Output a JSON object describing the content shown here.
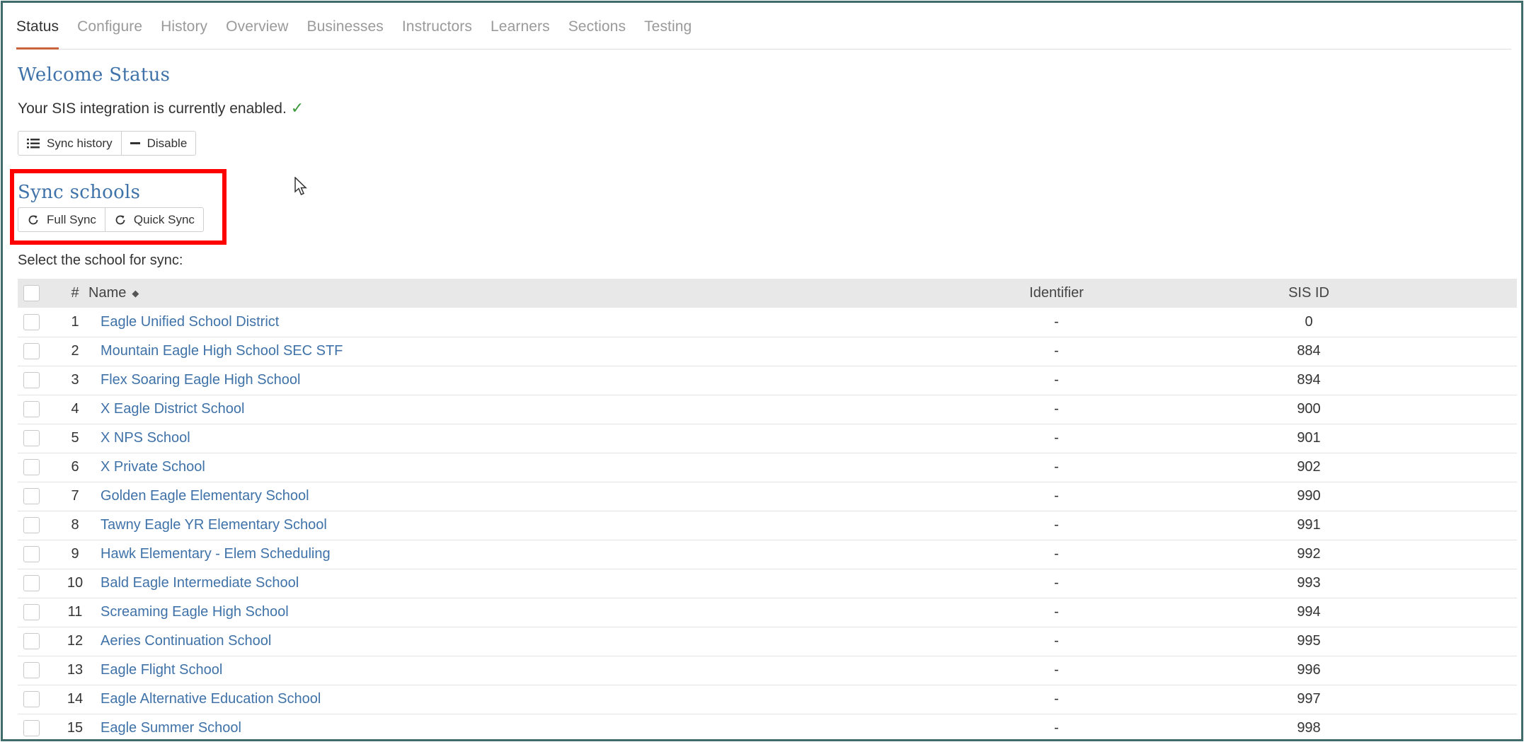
{
  "tabs": [
    {
      "label": "Status",
      "active": true
    },
    {
      "label": "Configure"
    },
    {
      "label": "History"
    },
    {
      "label": "Overview"
    },
    {
      "label": "Businesses"
    },
    {
      "label": "Instructors"
    },
    {
      "label": "Learners"
    },
    {
      "label": "Sections"
    },
    {
      "label": "Testing"
    }
  ],
  "welcome": {
    "title": "Welcome Status",
    "status_text": "Your SIS integration is currently enabled.",
    "status_icon": "check-icon",
    "buttons": {
      "sync_history": "Sync history",
      "disable": "Disable"
    }
  },
  "sync": {
    "title": "Sync schools",
    "full_sync": "Full Sync",
    "quick_sync": "Quick Sync",
    "select_label": "Select the school for sync:"
  },
  "table": {
    "headers": {
      "num": "#",
      "name": "Name",
      "identifier": "Identifier",
      "sis_id": "SIS ID"
    },
    "rows": [
      {
        "num": "1",
        "name": "Eagle Unified School District",
        "identifier": "-",
        "sis_id": "0"
      },
      {
        "num": "2",
        "name": "Mountain Eagle High School SEC STF",
        "identifier": "-",
        "sis_id": "884"
      },
      {
        "num": "3",
        "name": "Flex Soaring Eagle High School",
        "identifier": "-",
        "sis_id": "894"
      },
      {
        "num": "4",
        "name": "X Eagle District School",
        "identifier": "-",
        "sis_id": "900"
      },
      {
        "num": "5",
        "name": "X NPS School",
        "identifier": "-",
        "sis_id": "901"
      },
      {
        "num": "6",
        "name": "X Private School",
        "identifier": "-",
        "sis_id": "902"
      },
      {
        "num": "7",
        "name": "Golden Eagle Elementary School",
        "identifier": "-",
        "sis_id": "990"
      },
      {
        "num": "8",
        "name": "Tawny Eagle YR Elementary School",
        "identifier": "-",
        "sis_id": "991"
      },
      {
        "num": "9",
        "name": "Hawk Elementary - Elem Scheduling",
        "identifier": "-",
        "sis_id": "992"
      },
      {
        "num": "10",
        "name": "Bald Eagle Intermediate School",
        "identifier": "-",
        "sis_id": "993"
      },
      {
        "num": "11",
        "name": "Screaming Eagle High School",
        "identifier": "-",
        "sis_id": "994"
      },
      {
        "num": "12",
        "name": "Aeries Continuation School",
        "identifier": "-",
        "sis_id": "995"
      },
      {
        "num": "13",
        "name": "Eagle Flight School",
        "identifier": "-",
        "sis_id": "996"
      },
      {
        "num": "14",
        "name": "Eagle Alternative Education School",
        "identifier": "-",
        "sis_id": "997"
      },
      {
        "num": "15",
        "name": "Eagle Summer School",
        "identifier": "-",
        "sis_id": "998"
      }
    ]
  },
  "colors": {
    "accent_tab": "#c8643c",
    "link": "#3f72a8",
    "highlight": "#ff0000",
    "success": "#3a9a3a"
  }
}
